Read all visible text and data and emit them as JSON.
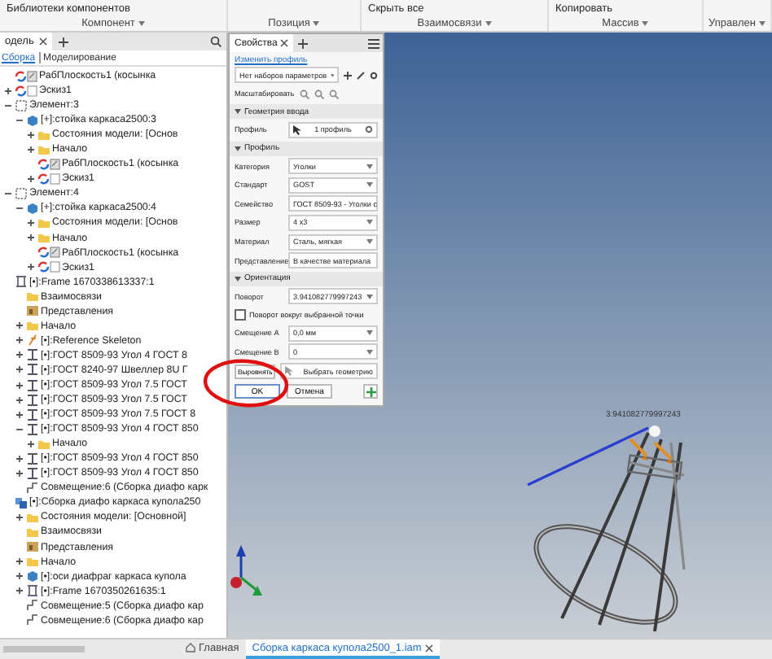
{
  "ribbon": {
    "groups": [
      {
        "label": "Компонент",
        "buttons": [
          "Библиотеки компонентов"
        ]
      },
      {
        "label": "Позиция"
      },
      {
        "label": "Взаимосвязи",
        "buttons": [
          "Скрыть все"
        ]
      },
      {
        "label": "Массив",
        "buttons": [
          "Копировать"
        ]
      },
      {
        "label": "Управлен"
      }
    ]
  },
  "browser": {
    "tab": "одель",
    "subtabs": [
      {
        "label": "Сборка",
        "selected": true
      },
      {
        "label": "Моделирование",
        "selected": false
      }
    ],
    "tree": [
      {
        "label": "РабПлоскость1 (косынка",
        "kind": "plane"
      },
      {
        "label": "Эскиз1",
        "kind": "sketch",
        "expanded": false
      },
      {
        "label": "Элемент:3",
        "kind": "element",
        "expanded": true,
        "children": [
          {
            "label": "[+]:стойка каркаса2500:3",
            "kind": "component",
            "expanded": true,
            "children": [
              {
                "label": "Состояния модели: [Основ",
                "kind": "folder",
                "expanded": false
              },
              {
                "label": "Начало",
                "kind": "folder",
                "expanded": false
              },
              {
                "label": "РабПлоскость1 (косынка",
                "kind": "plane"
              },
              {
                "label": "Эскиз1",
                "kind": "sketch",
                "expanded": false
              }
            ]
          }
        ]
      },
      {
        "label": "Элемент:4",
        "kind": "element",
        "expanded": true,
        "children": [
          {
            "label": "[+]:стойка каркаса2500:4",
            "kind": "component",
            "expanded": true,
            "children": [
              {
                "label": "Состояния модели: [Основ",
                "kind": "folder",
                "expanded": false
              },
              {
                "label": "Начало",
                "kind": "folder",
                "expanded": false
              },
              {
                "label": "РабПлоскость1 (косынка",
                "kind": "plane"
              },
              {
                "label": "Эскиз1",
                "kind": "sketch",
                "expanded": false
              }
            ]
          }
        ]
      },
      {
        "label": "[•]:Frame 1670338613337:1",
        "kind": "frame",
        "children": [
          {
            "label": "Взаимосвязи",
            "kind": "folder"
          },
          {
            "label": "Представления",
            "kind": "reps"
          },
          {
            "label": "Начало",
            "kind": "folder",
            "expanded": false
          },
          {
            "label": "[•]:Reference Skeleton",
            "kind": "skeleton",
            "expanded": false
          },
          {
            "label": "[•]:ГОСТ 8509-93 Угол 4 ГОСТ 8",
            "kind": "profile",
            "expanded": false
          },
          {
            "label": "[•]:ГОСТ 8240-97 Швеллер 8U Г",
            "kind": "profile",
            "expanded": false
          },
          {
            "label": "[•]:ГОСТ 8509-93 Угол 7.5 ГОСТ",
            "kind": "profile",
            "expanded": false
          },
          {
            "label": "[•]:ГОСТ 8509-93 Угол 7.5 ГОСТ",
            "kind": "profile",
            "expanded": false
          },
          {
            "label": "[•]:ГОСТ 8509-93 Угол 7.5 ГОСТ 8",
            "kind": "profile",
            "expanded": false
          },
          {
            "label": "[•]:ГОСТ 8509-93 Угол 4 ГОСТ 850",
            "kind": "profile",
            "expanded": true,
            "children": [
              {
                "label": "Начало",
                "kind": "folder",
                "expanded": false
              }
            ]
          },
          {
            "label": "[•]:ГОСТ 8509-93 Угол 4 ГОСТ 850",
            "kind": "profile",
            "expanded": false
          },
          {
            "label": "[•]:ГОСТ 8509-93 Угол 4 ГОСТ 850",
            "kind": "profile",
            "expanded": false
          },
          {
            "label": "Совмещение:6 (Сборка диафо карк",
            "kind": "constraint"
          }
        ]
      },
      {
        "label": "[•]:Сборка диафо каркаса купола250",
        "kind": "assembly",
        "children": [
          {
            "label": "Состояния модели: [Основной]",
            "kind": "folder",
            "expanded": false
          },
          {
            "label": "Взаимосвязи",
            "kind": "folder"
          },
          {
            "label": "Представления",
            "kind": "reps"
          },
          {
            "label": "Начало",
            "kind": "folder",
            "expanded": false
          },
          {
            "label": "[•]:оси диафраг каркаса купола",
            "kind": "component",
            "expanded": false
          },
          {
            "label": "[•]:Frame 1670350261635:1",
            "kind": "frame",
            "expanded": false
          },
          {
            "label": "Совмещение:5 (Сборка диафо кар",
            "kind": "constraint"
          },
          {
            "label": "Совмещение:6 (Сборка диафо кар",
            "kind": "constraint"
          }
        ]
      }
    ]
  },
  "properties": {
    "tab": "Свойства",
    "link": "Изменить профиль",
    "preset": "Нет наборов параметров",
    "zoom_label": "Масштабировать",
    "sections": [
      {
        "title": "Геометрия ввода",
        "rows": [
          {
            "kind": "selector",
            "label": "Профиль",
            "value": "1 профиль"
          }
        ]
      },
      {
        "title": "Профиль",
        "rows": [
          {
            "kind": "dropdown",
            "label": "Категория",
            "value": "Уголки"
          },
          {
            "kind": "dropdown",
            "label": "Стандарт",
            "value": "GOST"
          },
          {
            "kind": "dropdown",
            "label": "Семейство",
            "value": "ГОСТ 8509-93 - Уголки с"
          },
          {
            "kind": "dropdown",
            "label": "Размер",
            "value": "4 x3"
          },
          {
            "kind": "dropdown",
            "label": "Материал",
            "value": "Сталь, мягкая"
          },
          {
            "kind": "dropdown",
            "label": "Представление",
            "value": "В качестве материала"
          }
        ]
      },
      {
        "title": "Ориентация",
        "rows": [
          {
            "kind": "dropdown",
            "label": "Поворот",
            "value": "3.941082779997243"
          },
          {
            "kind": "checkbox",
            "label": "Поворот вокруг выбранной точки",
            "checked": false
          },
          {
            "kind": "dropdown",
            "label": "Смещение А",
            "value": "0,0 мм"
          },
          {
            "kind": "dropdown",
            "label": "Смещение B",
            "value": "0"
          },
          {
            "kind": "align",
            "label": "Выровнять",
            "value": "Выбрать геометрию"
          }
        ]
      }
    ],
    "buttons": [
      {
        "label": "OK",
        "kind": "primary"
      },
      {
        "label": "Отмена",
        "kind": "secondary"
      }
    ]
  },
  "viewport": {
    "dimension": "3.941082779997243"
  },
  "doc_tabs": [
    {
      "label": "Главная",
      "kind": "home",
      "selected": false
    },
    {
      "label": "Сборка каркаса купола2500_1.iam",
      "kind": "document",
      "selected": true
    }
  ]
}
